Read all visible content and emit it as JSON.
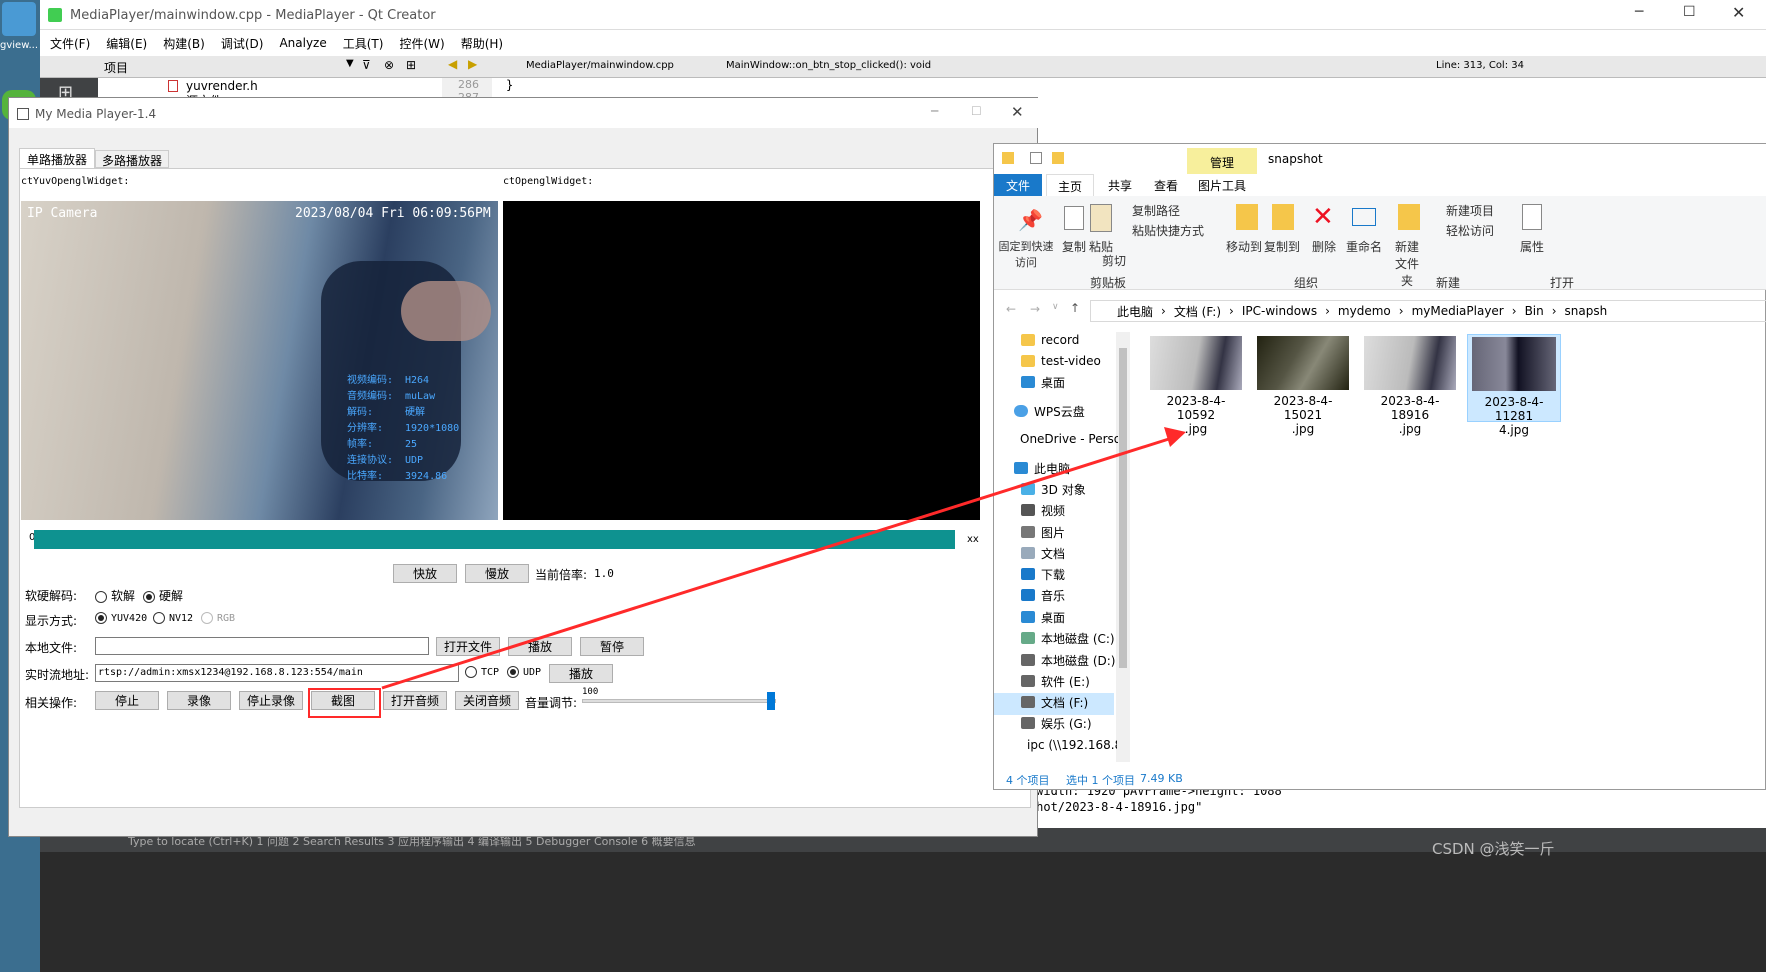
{
  "desktop": {
    "left_label": "gview..."
  },
  "qt": {
    "title": "MediaPlayer/mainwindow.cpp - MediaPlayer - Qt Creator",
    "menu": [
      "文件(F)",
      "编辑(E)",
      "构建(B)",
      "调试(D)",
      "Analyze",
      "工具(T)",
      "控件(W)",
      "帮助(H)"
    ],
    "project_label": "项目",
    "tree": [
      "yuvrender.h",
      "源文件"
    ],
    "file_tab": "MediaPlayer/mainwindow.cpp",
    "func": "MainWindow::on_btn_stop_clicked(): void",
    "pos": "Line: 313, Col: 34",
    "line_numbers": [
      "286",
      "287"
    ],
    "code_line": "}",
    "output_lines": [
      "ame->width: 1920  pAVFrame->height: 1088",
      "snapshot/2023-8-4-18916.jpg\""
    ],
    "bottom_tabs": "Type to locate (Ctrl+K)   1 问题   2 Search Results   3 应用程序输出   4 编译输出   5 Debugger Console   6 概要信息"
  },
  "player": {
    "title": "My Media Player-1.4",
    "tabs": [
      "单路播放器",
      "多路播放器"
    ],
    "label_left": "ctYuvOpenglWidget:",
    "label_right": "ctOpenglWidget:",
    "osd_camera": "IP  Camera",
    "osd_time": "2023/08/04  Fri  06:09:56PM",
    "info": [
      [
        "视频编码:",
        "H264"
      ],
      [
        "音频编码:",
        "muLaw"
      ],
      [
        "解码:",
        "硬解"
      ],
      [
        "分辨率:",
        "1920*1080"
      ],
      [
        "帧率:",
        "25"
      ],
      [
        "连接协议:",
        "UDP"
      ],
      [
        "比特率:",
        "3924.86"
      ]
    ],
    "progress_left": "0",
    "progress_right": "xx",
    "btn_fast": "快放",
    "btn_slow": "慢放",
    "rate_label": "当前倍率:",
    "rate_value": "1.0",
    "decode_label": "软硬解码:",
    "soft": "软解",
    "hard": "硬解",
    "display_label": "显示方式:",
    "yuv": "YUV420",
    "nv12": "NV12",
    "rgb": "RGB",
    "local_label": "本地文件:",
    "open_file": "打开文件",
    "play": "播放",
    "pause": "暂停",
    "stream_label": "实时流地址:",
    "stream_value": "rtsp://admin:xmsx1234@192.168.8.123:554/main",
    "tcp": "TCP",
    "udp": "UDP",
    "play2": "播放",
    "ops_label": "相关操作:",
    "stop": "停止",
    "record": "录像",
    "stop_record": "停止录像",
    "snapshot": "截图",
    "open_audio": "打开音频",
    "close_audio": "关闭音频",
    "volume_label": "音量调节:",
    "volume": "100",
    "volume_fraction": 1.0
  },
  "explorer": {
    "title": "snapshot",
    "manage": "管理",
    "tabs": [
      "文件",
      "主页",
      "共享",
      "查看",
      "图片工具"
    ],
    "ribbon": [
      "固定到快速访问",
      "复制",
      "粘贴",
      "复制路径",
      "粘贴快捷方式",
      "剪切",
      "剪贴板",
      "移动到",
      "复制到",
      "删除",
      "重命名",
      "组织",
      "新建文件夹",
      "新建项目",
      "轻松访问",
      "新建",
      "属性",
      "打开"
    ],
    "breadcrumb": [
      "此电脑",
      "文档 (F:)",
      "IPC-windows",
      "mydemo",
      "myMediaPlayer",
      "Bin",
      "snapsh"
    ],
    "nav": [
      "record",
      "test-video",
      "桌面",
      "WPS云盘",
      "OneDrive - Perso",
      "此电脑",
      "3D 对象",
      "视频",
      "图片",
      "文档",
      "下载",
      "音乐",
      "桌面",
      "本地磁盘 (C:)",
      "本地磁盘 (D:)",
      "软件 (E:)",
      "文档 (F:)",
      "娱乐 (G:)",
      "ipc (\\\\192.168.8"
    ],
    "files": [
      "2023-8-4-10592.jpg",
      "2023-8-4-15021.jpg",
      "2023-8-4-18916.jpg",
      "2023-8-4-112814.jpg"
    ],
    "files_line1": [
      "2023-8-4-10592",
      "2023-8-4-15021",
      "2023-8-4-18916",
      "2023-8-4-11281"
    ],
    "files_line2": [
      ".jpg",
      ".jpg",
      ".jpg",
      "4.jpg"
    ],
    "status": [
      "4 个项目",
      "选中 1 个项目",
      "7.49 KB"
    ]
  },
  "watermark": "CSDN @浅笑一斤",
  "colors": {
    "progress": "#0e9290",
    "accent": "#0078d7",
    "highlight": "#ff2a2a"
  }
}
